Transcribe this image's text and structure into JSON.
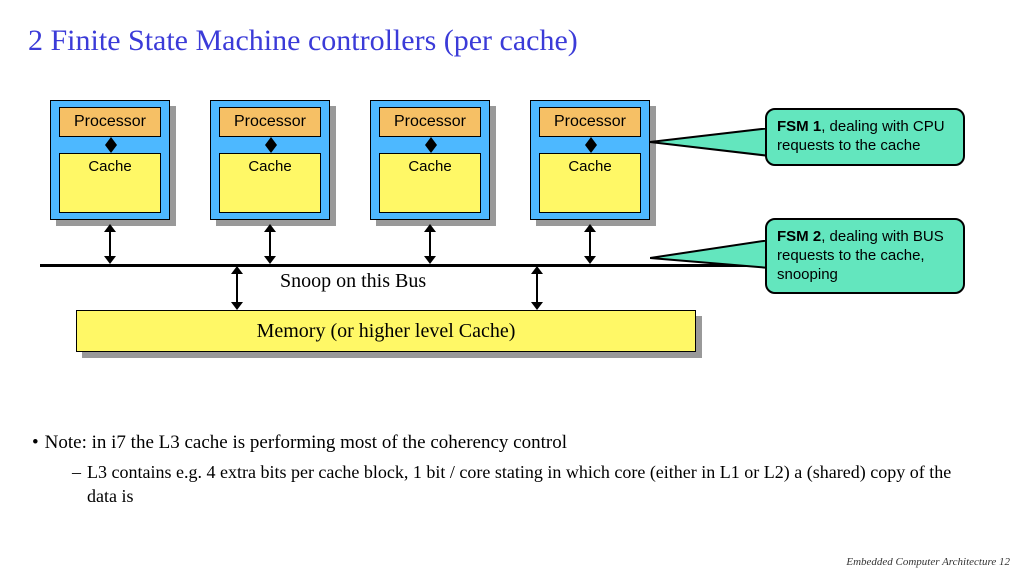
{
  "title": "2 Finite State Machine controllers (per cache)",
  "nodes": [
    {
      "proc": "Processor",
      "cache": "Cache"
    },
    {
      "proc": "Processor",
      "cache": "Cache"
    },
    {
      "proc": "Processor",
      "cache": "Cache"
    },
    {
      "proc": "Processor",
      "cache": "Cache"
    }
  ],
  "snoop_label": "Snoop on this Bus",
  "memory_label": "Memory (or higher level Cache)",
  "callouts": {
    "fsm1": {
      "bold": "FSM 1",
      "rest": ", dealing with CPU requests to the cache"
    },
    "fsm2": {
      "bold": "FSM 2",
      "rest": ", dealing with BUS requests to the cache, snooping"
    }
  },
  "notes": {
    "main": "Note: in i7 the L3 cache is performing most of the coherency control",
    "sub": "L3 contains e.g. 4 extra bits per cache block, 1 bit / core  stating in which core (either in L1 or L2)  a (shared) copy of the data is"
  },
  "footer": "Embedded Computer Architecture  12"
}
